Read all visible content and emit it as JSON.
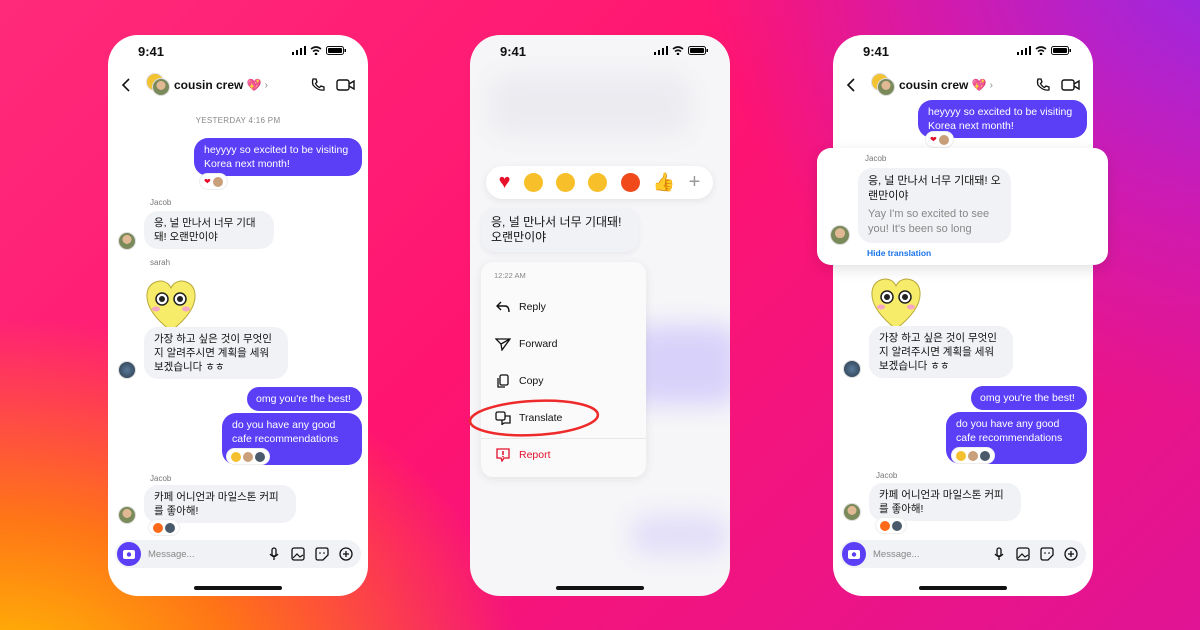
{
  "status": {
    "time": "9:41"
  },
  "chat": {
    "title": "cousin crew 💖",
    "timestamp": "YESTERDAY 4:16 PM"
  },
  "messages": {
    "m1": "heyyyy so excited to be visiting Korea next month!",
    "jacob": "Jacob",
    "sarah": "sarah",
    "m2": "응, 널 만나서 너무 기대돼! 오랜만이야",
    "m3": "가장 하고 싶은 것이 무엇인지 알려주시면 계획을 세워보겠습니다 ㅎㅎ",
    "m4": "omg you're the best!",
    "m5": "do you have any good cafe recommendations 👁",
    "m6": "카페 어니언과 마일스톤 커피를 좋아해!"
  },
  "composer": {
    "placeholder": "Message..."
  },
  "context_menu": {
    "reactions": [
      "heart",
      "grinning",
      "astonished",
      "crying",
      "angry",
      "thumbs-up",
      "plus"
    ],
    "time": "12:22 AM",
    "items": [
      {
        "label": "Reply",
        "icon": "reply-icon"
      },
      {
        "label": "Forward",
        "icon": "send-icon"
      },
      {
        "label": "Copy",
        "icon": "copy-icon"
      },
      {
        "label": "Translate",
        "icon": "translate-icon"
      },
      {
        "label": "Report",
        "icon": "report-icon"
      }
    ],
    "highlighted": "Translate"
  },
  "translation": {
    "text": "Yay I'm so excited to see you! It's been so long",
    "hide_label": "Hide translation"
  },
  "colors": {
    "accent": "#5a3ff6",
    "danger": "#e0102a",
    "link": "#1a73e8"
  }
}
